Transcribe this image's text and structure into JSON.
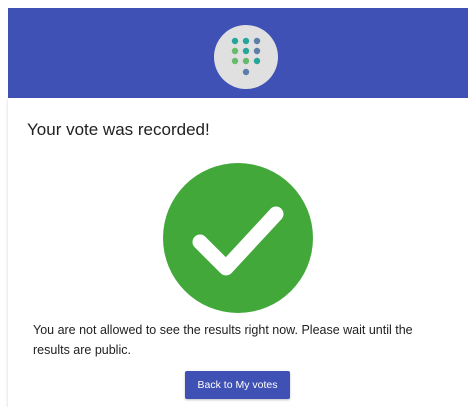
{
  "colors": {
    "header": "#3f51b5",
    "logo_bg": "#e0e0e0",
    "logo_dot_green": "#66bb6a",
    "logo_dot_teal": "#26a69a",
    "logo_dot_blue": "#5c7ea8",
    "success": "#43a83a",
    "button": "#3f51b5"
  },
  "header": {
    "logo_icon": "dial-pad-dots-logo"
  },
  "card": {
    "title": "Your vote was recorded!",
    "status_icon": "checkmark-circle",
    "message": "You are not allowed to see the results right now. Please wait until the results are public.",
    "back_button_label": "Back to My votes"
  }
}
